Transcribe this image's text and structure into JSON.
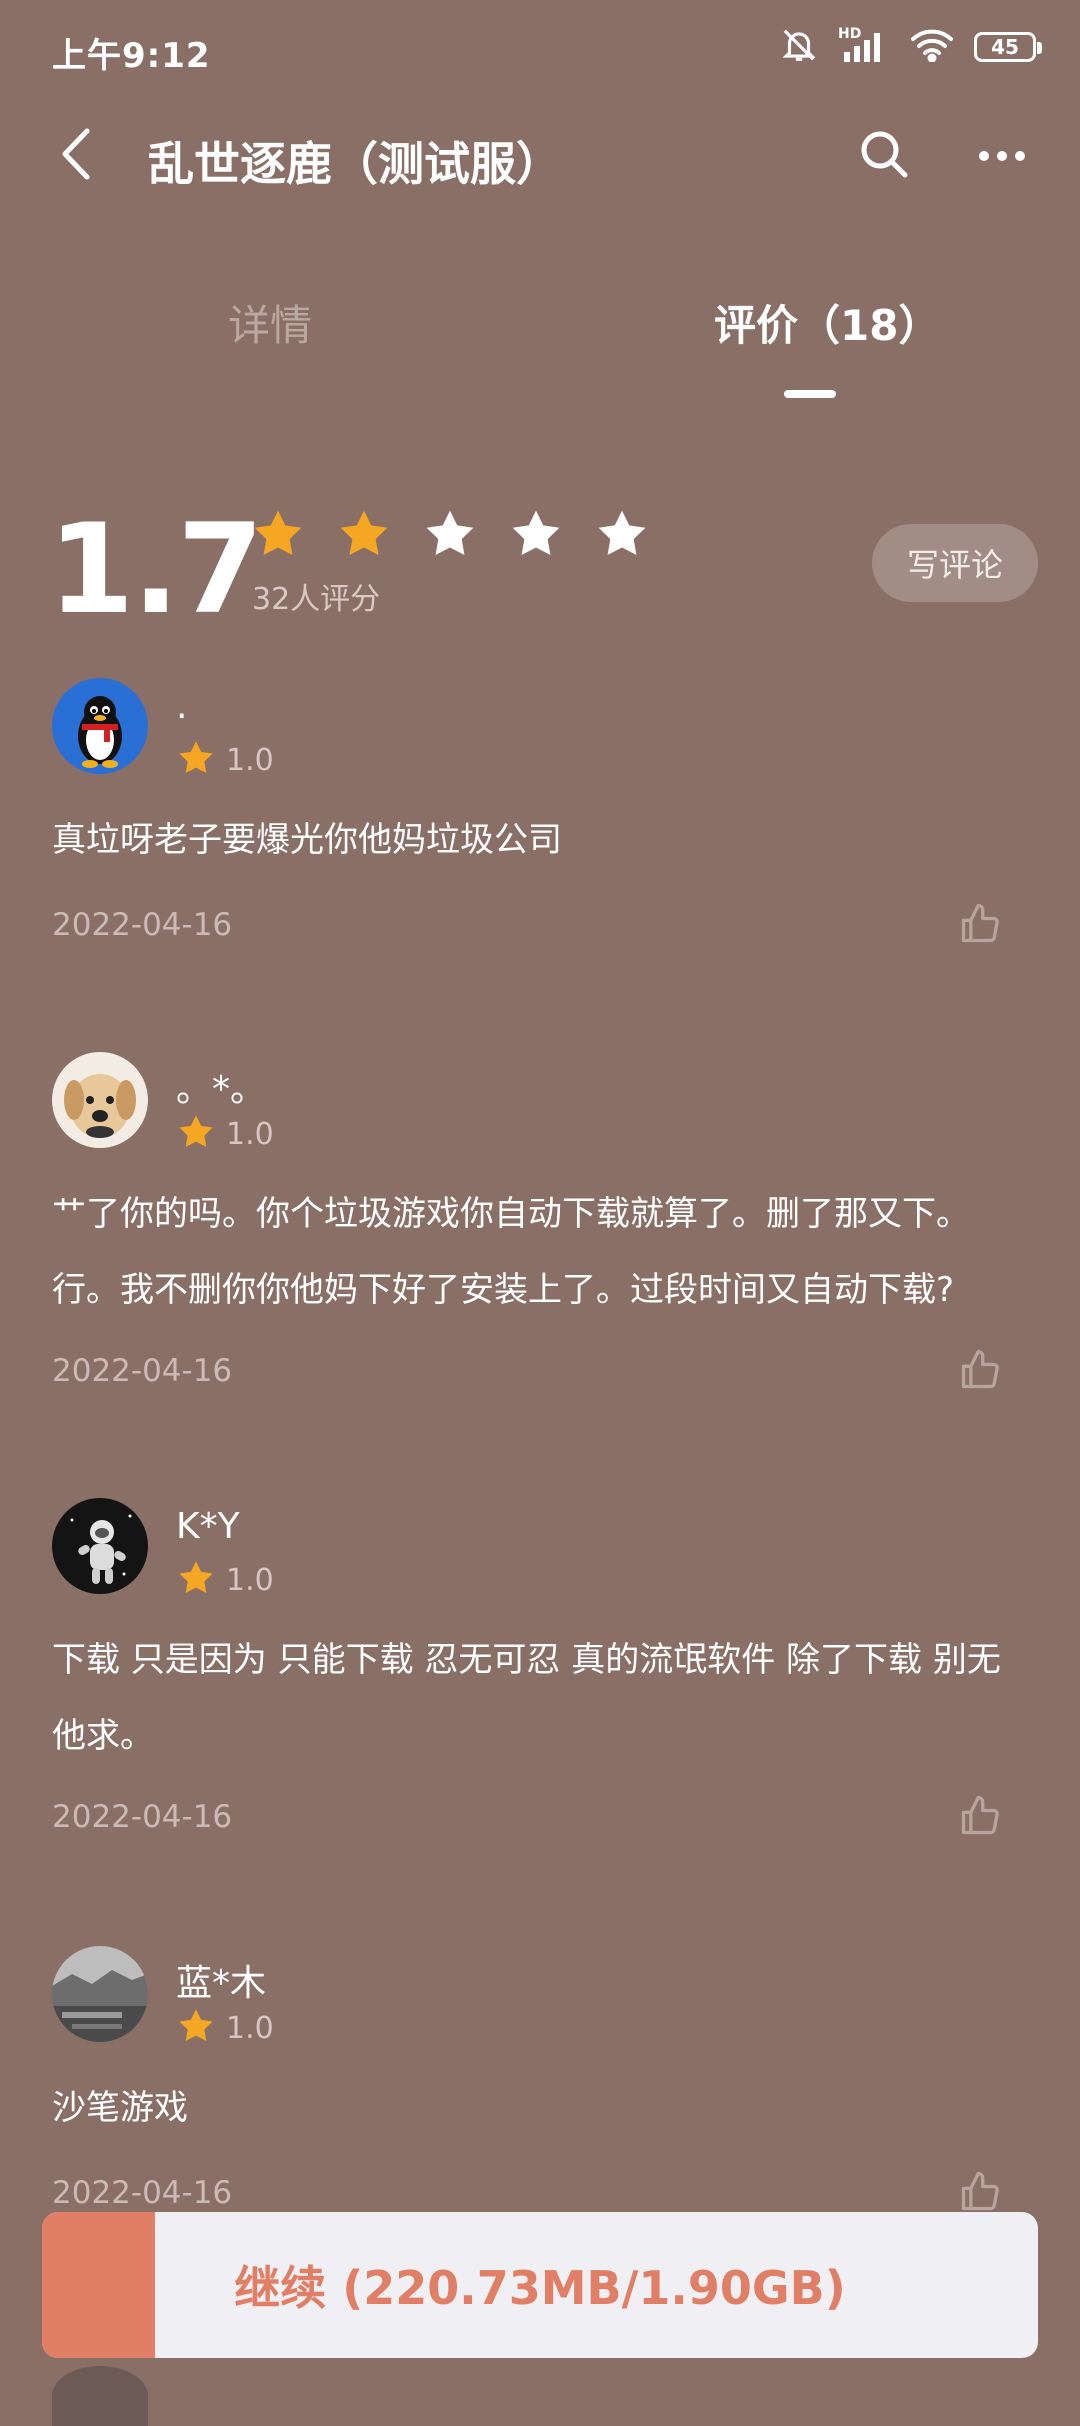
{
  "status_bar": {
    "time": "上午9:12",
    "network": "HD",
    "battery": "45"
  },
  "header": {
    "title": "乱世逐鹿（测试服）",
    "back_icon": "back-arrow-icon",
    "search_icon": "search-icon",
    "more_icon": "more-dots-icon"
  },
  "tabs": [
    {
      "label": "详情",
      "active": false
    },
    {
      "label": "评价（18）",
      "active": true
    }
  ],
  "summary": {
    "score": "1.7",
    "stars_filled": 2,
    "stars_total": 5,
    "count_label": "32人评分",
    "write_review_label": "写评论"
  },
  "reviews": [
    {
      "user": ".",
      "rating": "1.0",
      "text": "真垃呀老子要爆光你他妈垃圾公司",
      "date": "2022-04-16",
      "avatar": "penguin-avatar"
    },
    {
      "user": "。*。",
      "rating": "1.0",
      "text": "艹了你的吗。你个垃圾游戏你自动下载就算了。删了那又下。行。我不删你你他妈下好了安装上了。过段时间又自动下载?",
      "date": "2022-04-16",
      "avatar": "dog-avatar"
    },
    {
      "user": "K*Y",
      "rating": "1.0",
      "text": "下载 只是因为 只能下载 忍无可忍 真的流氓软件 除了下载 别无他求。",
      "date": "2022-04-16",
      "avatar": "astronaut-avatar"
    },
    {
      "user": "蓝*木",
      "rating": "1.0",
      "text": "沙笔游戏",
      "date": "2022-04-16",
      "avatar": "landscape-avatar"
    }
  ],
  "continue_button": {
    "label": "继续 (220.73MB/1.90GB)",
    "progress": 0.113
  },
  "colors": {
    "background": "#8a6f67",
    "star": "#f5a623",
    "accent": "#e07f66"
  }
}
